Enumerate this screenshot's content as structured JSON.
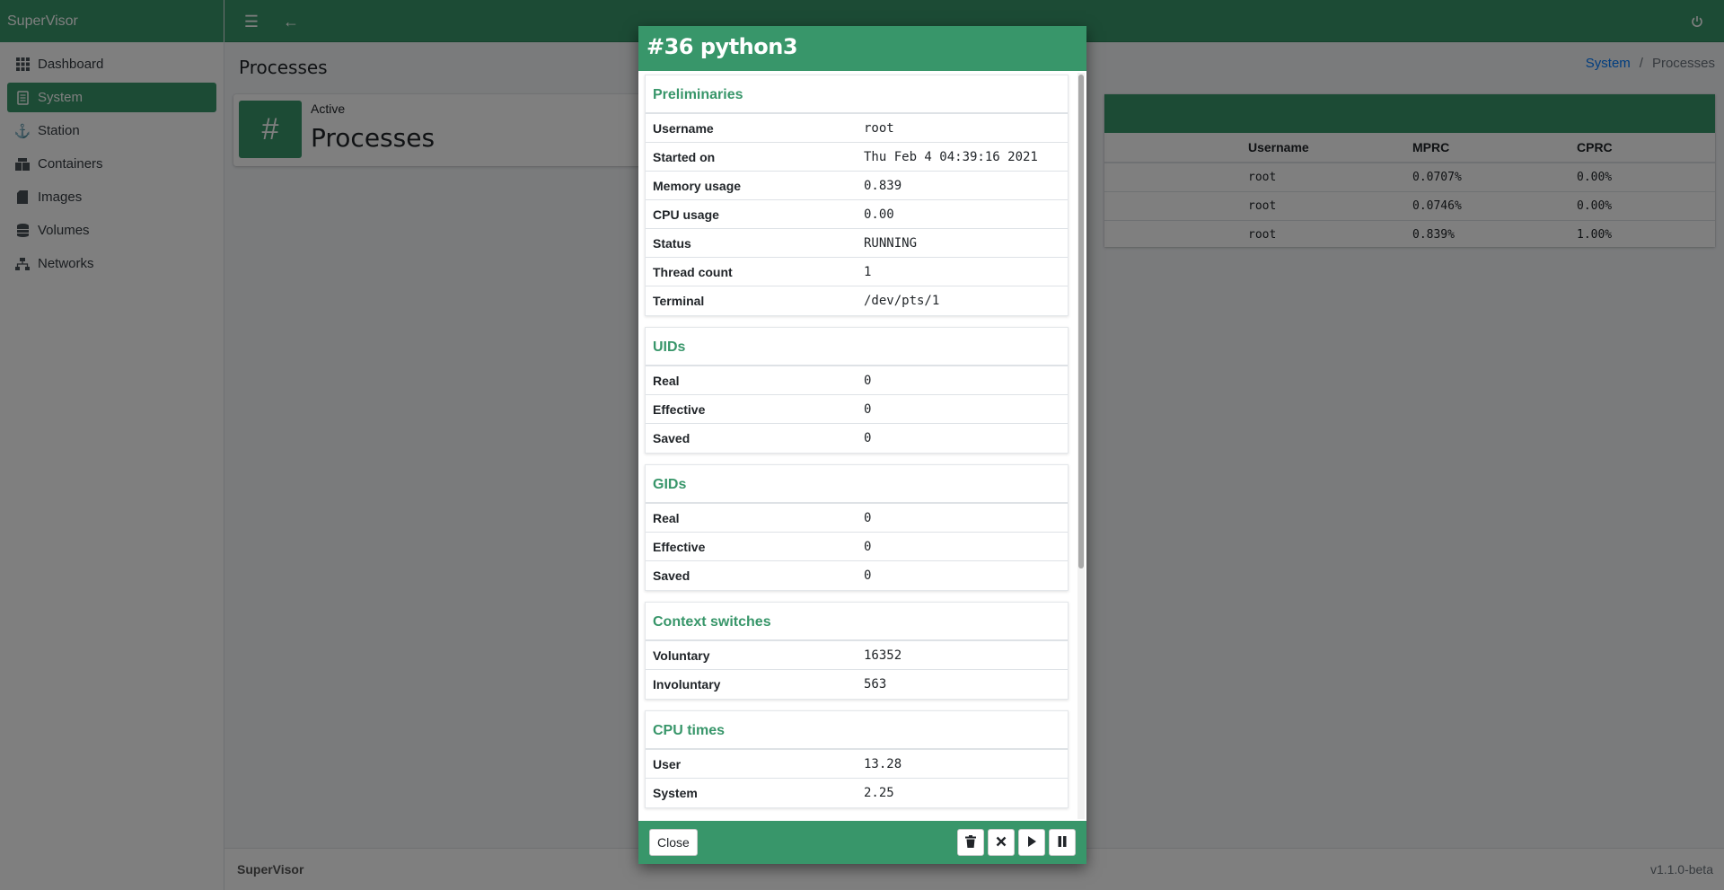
{
  "app": {
    "brand": "SuperVisor"
  },
  "sidebar": {
    "items": [
      {
        "label": "Dashboard",
        "icon": "grid-icon"
      },
      {
        "label": "System",
        "icon": "server-icon",
        "active": true
      },
      {
        "label": "Station",
        "icon": "anchor-icon"
      },
      {
        "label": "Containers",
        "icon": "boxes-icon"
      },
      {
        "label": "Images",
        "icon": "sd-card-icon"
      },
      {
        "label": "Volumes",
        "icon": "database-icon"
      },
      {
        "label": "Networks",
        "icon": "network-icon"
      }
    ]
  },
  "header": {
    "page_title": "Processes",
    "breadcrumb": [
      "System",
      "Processes"
    ]
  },
  "info_box": {
    "label": "Active",
    "value": "Processes",
    "icon_glyph": "#"
  },
  "process_table": {
    "columns": [
      "Username",
      "MPRC",
      "CPRC"
    ],
    "rows": [
      [
        "root",
        "0.0707%",
        "0.00%"
      ],
      [
        "root",
        "0.0746%",
        "0.00%"
      ],
      [
        "root",
        "0.839%",
        "1.00%"
      ]
    ]
  },
  "footer": {
    "left": "SuperVisor",
    "right": "v1.1.0-beta"
  },
  "modal": {
    "title": "#36 python3",
    "sections": [
      {
        "title": "Preliminaries",
        "rows": [
          [
            "Username",
            "root"
          ],
          [
            "Started on",
            "Thu Feb 4 04:39:16 2021"
          ],
          [
            "Memory usage",
            "0.839"
          ],
          [
            "CPU usage",
            "0.00"
          ],
          [
            "Status",
            "RUNNING"
          ],
          [
            "Thread count",
            "1"
          ],
          [
            "Terminal",
            "/dev/pts/1"
          ]
        ]
      },
      {
        "title": "UIDs",
        "rows": [
          [
            "Real",
            "0"
          ],
          [
            "Effective",
            "0"
          ],
          [
            "Saved",
            "0"
          ]
        ]
      },
      {
        "title": "GIDs",
        "rows": [
          [
            "Real",
            "0"
          ],
          [
            "Effective",
            "0"
          ],
          [
            "Saved",
            "0"
          ]
        ]
      },
      {
        "title": "Context switches",
        "rows": [
          [
            "Voluntary",
            "16352"
          ],
          [
            "Involuntary",
            "563"
          ]
        ]
      },
      {
        "title": "CPU times",
        "rows": [
          [
            "User",
            "13.28"
          ],
          [
            "System",
            "2.25"
          ]
        ]
      }
    ],
    "close_label": "Close",
    "actions": [
      "trash-icon",
      "kill-icon",
      "play-icon",
      "pause-icon"
    ]
  },
  "colors": {
    "accent": "#38966a",
    "link": "#007bff"
  }
}
